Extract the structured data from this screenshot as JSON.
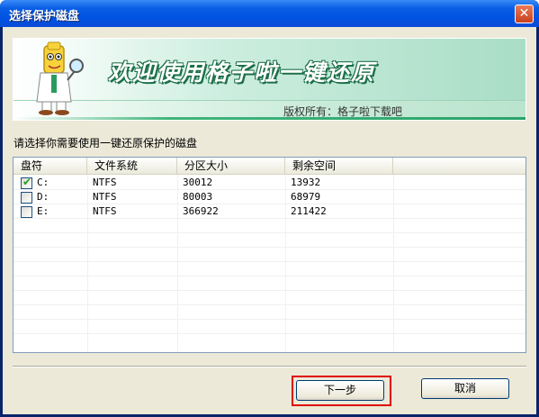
{
  "window": {
    "title": "选择保护磁盘",
    "close_glyph": "✕"
  },
  "banner": {
    "title": "欢迎使用格子啦一键还原",
    "copyright": "版权所有：格子啦下载吧",
    "mascot_icon": "mascot-magnifier-icon"
  },
  "prompt": "请选择你需要使用一键还原保护的磁盘",
  "table": {
    "columns": [
      "盘符",
      "文件系统",
      "分区大小",
      "剩余空间"
    ],
    "rows": [
      {
        "checked": true,
        "drive": "C:",
        "fs": "NTFS",
        "size": "30012",
        "free": "13932"
      },
      {
        "checked": false,
        "drive": "D:",
        "fs": "NTFS",
        "size": "80003",
        "free": "68979"
      },
      {
        "checked": false,
        "drive": "E:",
        "fs": "NTFS",
        "size": "366922",
        "free": "211422"
      }
    ]
  },
  "buttons": {
    "next_label": "下一步",
    "cancel_label": "取消"
  },
  "colors": {
    "title_bar": "#0054e3",
    "banner_accent": "#2aa36a",
    "highlight_border": "#e00000"
  }
}
